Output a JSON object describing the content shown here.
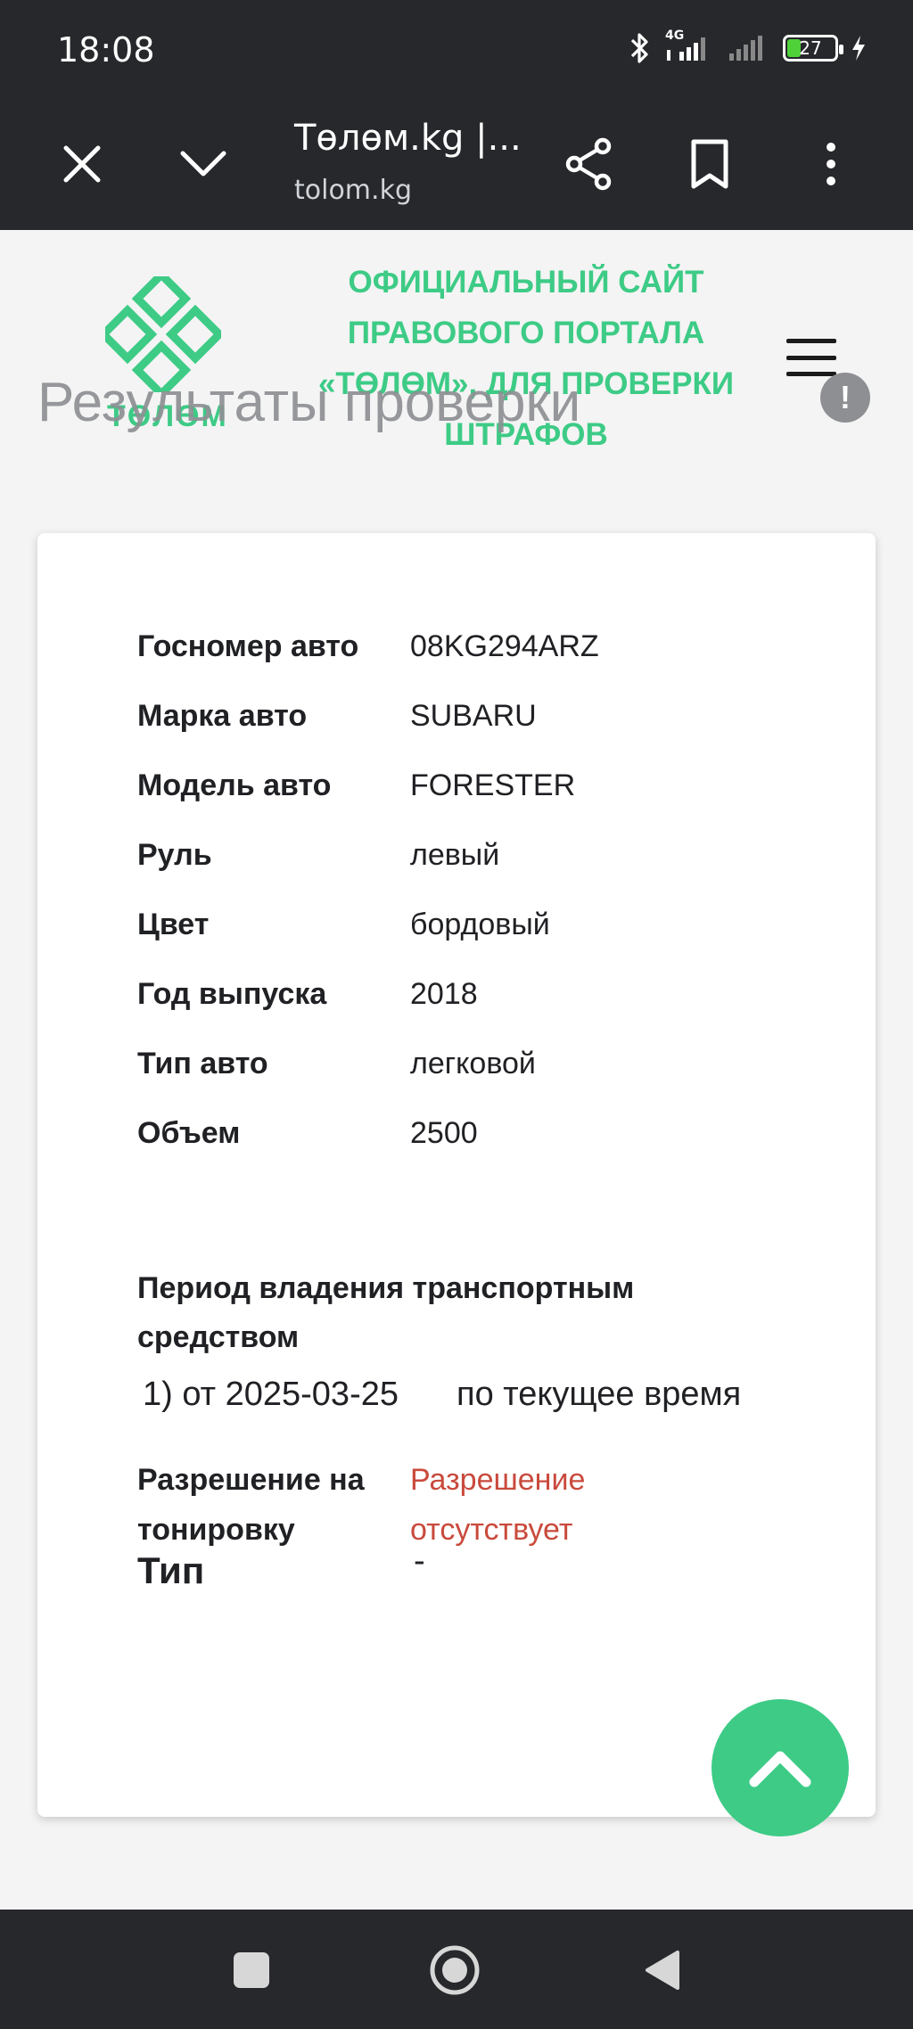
{
  "status_bar": {
    "time": "18:08",
    "network_label": "4G",
    "battery_level": "27",
    "icons": [
      "bluetooth-icon",
      "signal-4g-icon",
      "signal-icon",
      "battery-icon",
      "charging-icon"
    ]
  },
  "browser": {
    "page_title": "Төлөм.kg |...",
    "url": "tolom.kg",
    "icons": [
      "close-icon",
      "chevron-down-icon",
      "share-icon",
      "bookmark-icon",
      "more-vert-icon"
    ]
  },
  "site": {
    "logo_text": "ТӨЛӨМ",
    "tagline": "ОФИЦИАЛЬНЫЙ САЙТ ПРАВОВОГО ПОРТАЛА «ТӨЛӨМ», ДЛЯ ПРОВЕРКИ ШТРАФОВ",
    "page_heading": "Результаты проверки",
    "accent_color": "#3dcb86"
  },
  "vehicle": {
    "rows": [
      {
        "label": "Госномер авто",
        "value": "08KG294ARZ"
      },
      {
        "label": "Марка авто",
        "value": "SUBARU"
      },
      {
        "label": "Модель авто",
        "value": "FORESTER"
      },
      {
        "label": "Руль",
        "value": "левый"
      },
      {
        "label": "Цвет",
        "value": "бордовый"
      },
      {
        "label": "Год выпуска",
        "value": "2018"
      },
      {
        "label": "Тип авто",
        "value": "легковой"
      },
      {
        "label": "Объем",
        "value": "2500"
      }
    ],
    "ownership_title": "Период владения транспортным средством",
    "ownership_from": "1) от 2025-03-25",
    "ownership_to": "по текущее время",
    "tint_label": "Разрешение на тонировку",
    "tint_value": "Разрешение отсутствует",
    "tint_value_color": "#c94a3c",
    "type_label": "Тип",
    "type_value": "-"
  },
  "nav_bar": {
    "icons": [
      "recents-square-icon",
      "home-circle-icon",
      "back-triangle-icon"
    ]
  }
}
